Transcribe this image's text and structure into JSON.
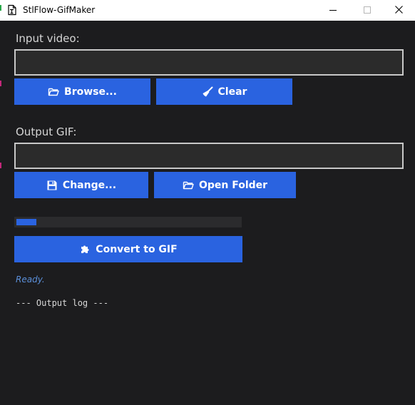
{
  "window": {
    "title": "StlFlow-GifMaker",
    "icon": "app-document-icon",
    "controls": [
      "minimize-icon",
      "maximize-icon",
      "close-icon"
    ]
  },
  "colors": {
    "background": "#1c1c1e",
    "accent": "#2a63e0",
    "status": "#5b8fd9"
  },
  "input": {
    "label": "Input video:",
    "value": "",
    "browse_label": "Browse...",
    "browse_icon": "folder-open-icon",
    "clear_label": "Clear",
    "clear_icon": "broom-icon"
  },
  "output": {
    "label": "Output GIF:",
    "value": "",
    "change_label": "Change...",
    "change_icon": "floppy-disk-icon",
    "open_folder_label": "Open Folder",
    "open_folder_icon": "folder-open-icon"
  },
  "progress": {
    "value": 0.09
  },
  "convert": {
    "label": "Convert to GIF",
    "icon": "puzzle-icon"
  },
  "status": {
    "text": "Ready."
  },
  "log": {
    "text": "--- Output log ---"
  }
}
